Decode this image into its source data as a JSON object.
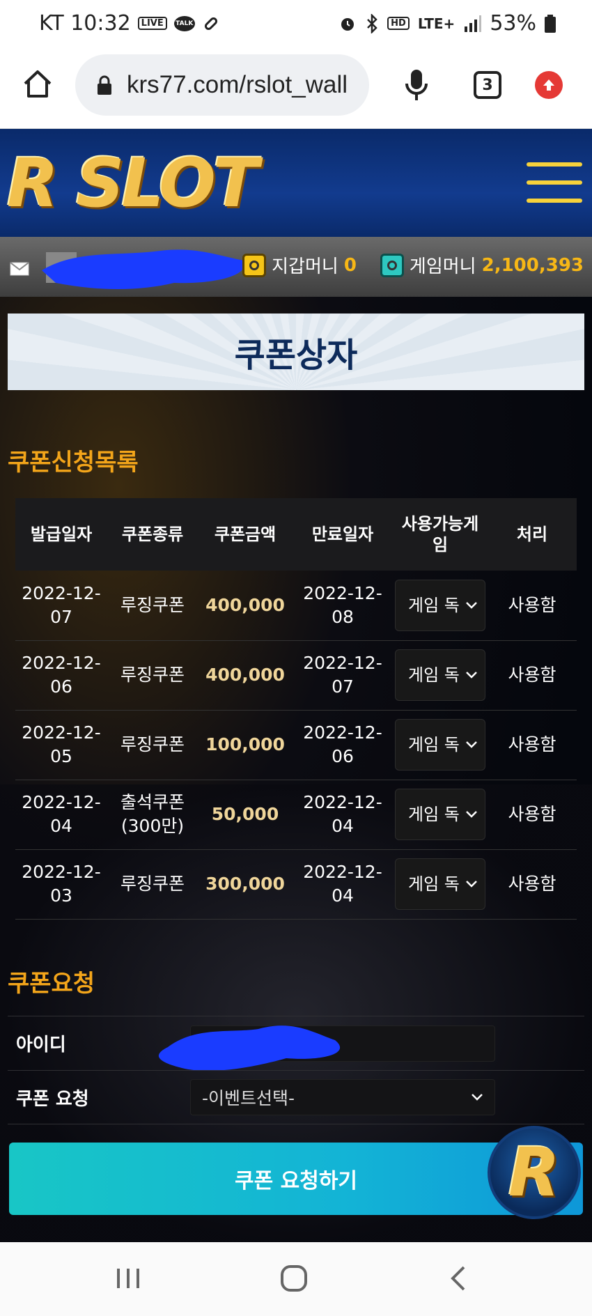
{
  "status_bar": {
    "carrier_time": "KT 10:32",
    "live_badge": "LIVE",
    "talk_badge": "TALK",
    "network": "LTE+",
    "battery": "53%"
  },
  "browser": {
    "url": "krs77.com/rslot_wall",
    "tab_count": "3"
  },
  "site": {
    "logo": "R SLOT",
    "wallet_label": "지갑머니",
    "wallet_value": "0",
    "game_label": "게임머니",
    "game_value": "2,100,393"
  },
  "page_title": "쿠폰상자",
  "list_section_title": "쿠폰신청목록",
  "table": {
    "headers": [
      "발급일자",
      "쿠폰종류",
      "쿠폰금액",
      "만료일자",
      "사용가능게임",
      "처리"
    ],
    "rows": [
      {
        "issued": "2022-12-07",
        "type": "루징쿠폰",
        "amount": "400,000",
        "expires": "2022-12-08",
        "game": "게임 독",
        "status": "사용함"
      },
      {
        "issued": "2022-12-06",
        "type": "루징쿠폰",
        "amount": "400,000",
        "expires": "2022-12-07",
        "game": "게임 독",
        "status": "사용함"
      },
      {
        "issued": "2022-12-05",
        "type": "루징쿠폰",
        "amount": "100,000",
        "expires": "2022-12-06",
        "game": "게임 독",
        "status": "사용함"
      },
      {
        "issued": "2022-12-04",
        "type": "출석쿠폰(300만)",
        "amount": "50,000",
        "expires": "2022-12-04",
        "game": "게임 독",
        "status": "사용함"
      },
      {
        "issued": "2022-12-03",
        "type": "루징쿠폰",
        "amount": "300,000",
        "expires": "2022-12-04",
        "game": "게임 독",
        "status": "사용함"
      }
    ]
  },
  "request_section_title": "쿠폰요청",
  "form": {
    "id_label": "아이디",
    "coupon_label": "쿠폰 요청",
    "coupon_select": "-이벤트선택-",
    "submit_label": "쿠폰 요청하기"
  },
  "badge_letter": "R",
  "colors": {
    "accent_gold": "#f3a51a",
    "header_blue": "#123b8e",
    "submit_teal": "#18c6c6"
  }
}
